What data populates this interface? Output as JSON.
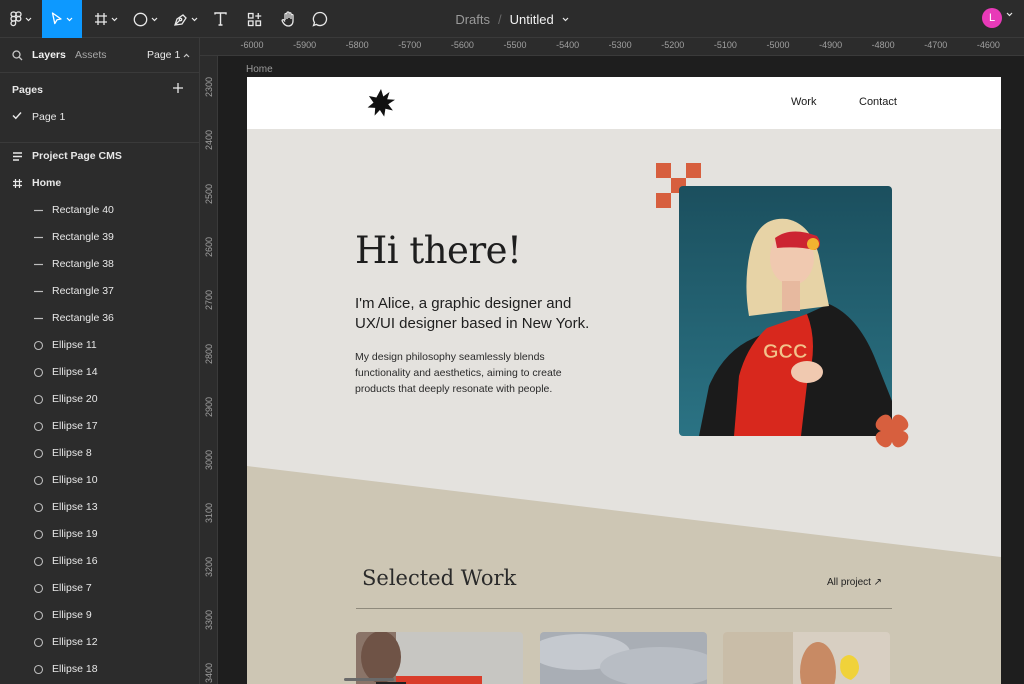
{
  "toolbar": {
    "file": {
      "project": "Drafts",
      "separator": "/",
      "name": "Untitled"
    },
    "avatar_initial": "L",
    "colors": {
      "accent": "#0d99ff",
      "avatar": "#e83ab8",
      "bg": "#2c2c2c"
    }
  },
  "sidebar": {
    "tabs": {
      "layers": "Layers",
      "assets": "Assets",
      "page_selector": "Page 1"
    },
    "pages_title": "Pages",
    "pages": [
      {
        "label": "Page 1",
        "selected": true
      }
    ],
    "layers": [
      {
        "label": "Project Page CMS",
        "type": "component"
      },
      {
        "label": "Home",
        "type": "frame"
      },
      {
        "label": "Rectangle 40",
        "type": "line"
      },
      {
        "label": "Rectangle 39",
        "type": "line"
      },
      {
        "label": "Rectangle 38",
        "type": "line"
      },
      {
        "label": "Rectangle 37",
        "type": "line"
      },
      {
        "label": "Rectangle 36",
        "type": "line"
      },
      {
        "label": "Ellipse 11",
        "type": "ellipse"
      },
      {
        "label": "Ellipse 14",
        "type": "ellipse"
      },
      {
        "label": "Ellipse 20",
        "type": "ellipse"
      },
      {
        "label": "Ellipse 17",
        "type": "ellipse"
      },
      {
        "label": "Ellipse 8",
        "type": "ellipse"
      },
      {
        "label": "Ellipse 10",
        "type": "ellipse"
      },
      {
        "label": "Ellipse 13",
        "type": "ellipse"
      },
      {
        "label": "Ellipse 19",
        "type": "ellipse"
      },
      {
        "label": "Ellipse 16",
        "type": "ellipse"
      },
      {
        "label": "Ellipse 7",
        "type": "ellipse"
      },
      {
        "label": "Ellipse 9",
        "type": "ellipse"
      },
      {
        "label": "Ellipse 12",
        "type": "ellipse"
      },
      {
        "label": "Ellipse 18",
        "type": "ellipse"
      }
    ]
  },
  "rulers": {
    "horizontal": [
      "-6000",
      "-5900",
      "-5800",
      "-5700",
      "-5600",
      "-5500",
      "-5400",
      "-5300",
      "-5200",
      "-5100",
      "-5000",
      "-4900",
      "-4800",
      "-4700",
      "-4600"
    ],
    "vertical": [
      "2300",
      "2400",
      "2500",
      "2600",
      "2700",
      "2800",
      "2900",
      "3000",
      "3100",
      "3200",
      "3300",
      "3400"
    ]
  },
  "canvas": {
    "frame_label": "Home",
    "site": {
      "nav": {
        "work": "Work",
        "contact": "Contact"
      },
      "hero": {
        "title": "Hi there!",
        "subtitle": "I'm Alice, a graphic designer and UX/UI designer based in New York.",
        "body": "My design philosophy seamlessly blends functionality and aesthetics, aiming to create products that deeply resonate with people."
      },
      "selected_work": {
        "title": "Selected Work",
        "link": "All project ↗"
      },
      "colors": {
        "accent": "#d75f3e",
        "hero_bg": "#e4e2de",
        "section_bg": "#cdc6b4",
        "photo_bg": "#1f5a68"
      }
    }
  }
}
